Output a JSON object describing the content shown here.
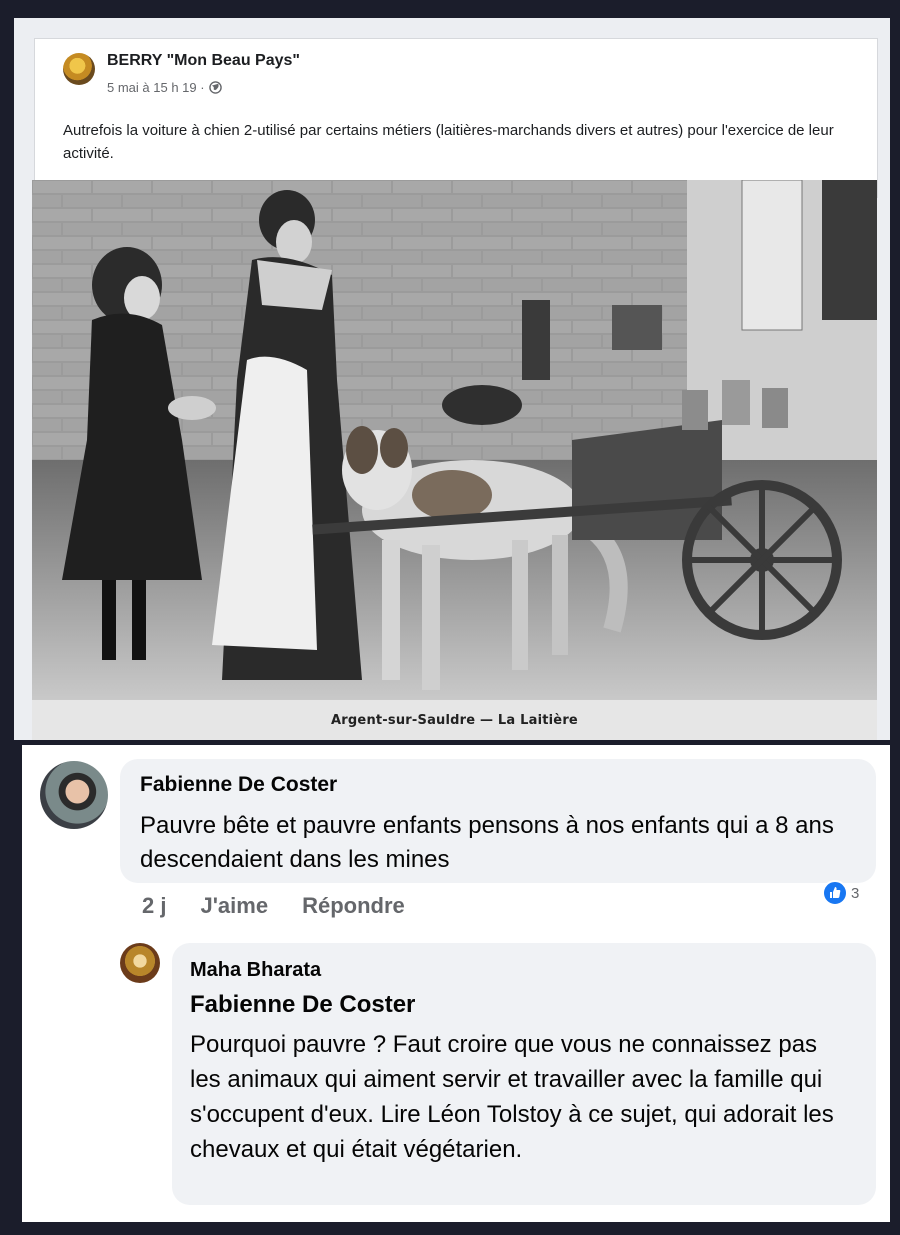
{
  "post": {
    "author": "BERRY \"Mon Beau Pays\"",
    "meta": "5 mai à 15 h 19 ·",
    "privacy_icon": "globe-icon",
    "text": "Autrefois la voiture à chien 2-utilisé par certains métiers (laitières-marchands divers et autres) pour l'exercice de leur activité.",
    "photo": {
      "caption": "Argent-sur-Sauldre — La Laitière"
    }
  },
  "comments": [
    {
      "author": "Fabienne De Coster",
      "text": "Pauvre bête et pauvre enfants pensons à nos enfants qui a 8 ans descendaient dans les mines",
      "time": "2 j",
      "like_label": "J'aime",
      "reply_label": "Répondre",
      "reaction_count": "3",
      "reaction_icon": "like-icon"
    },
    {
      "author": "Maha Bharata",
      "mention": "Fabienne De Coster",
      "text": "Pourquoi pauvre ? Faut croire que vous ne connaissez pas les animaux qui aiment servir et travailler avec la famille qui s'occupent d'eux. Lire Léon Tolstoy à ce sujet, qui adorait les chevaux et qui était végétarien."
    }
  ],
  "colors": {
    "page_background": "#1b1d2b",
    "bubble": "#f0f2f5",
    "like_blue": "#1877f2",
    "secondary_text": "#65676b"
  }
}
